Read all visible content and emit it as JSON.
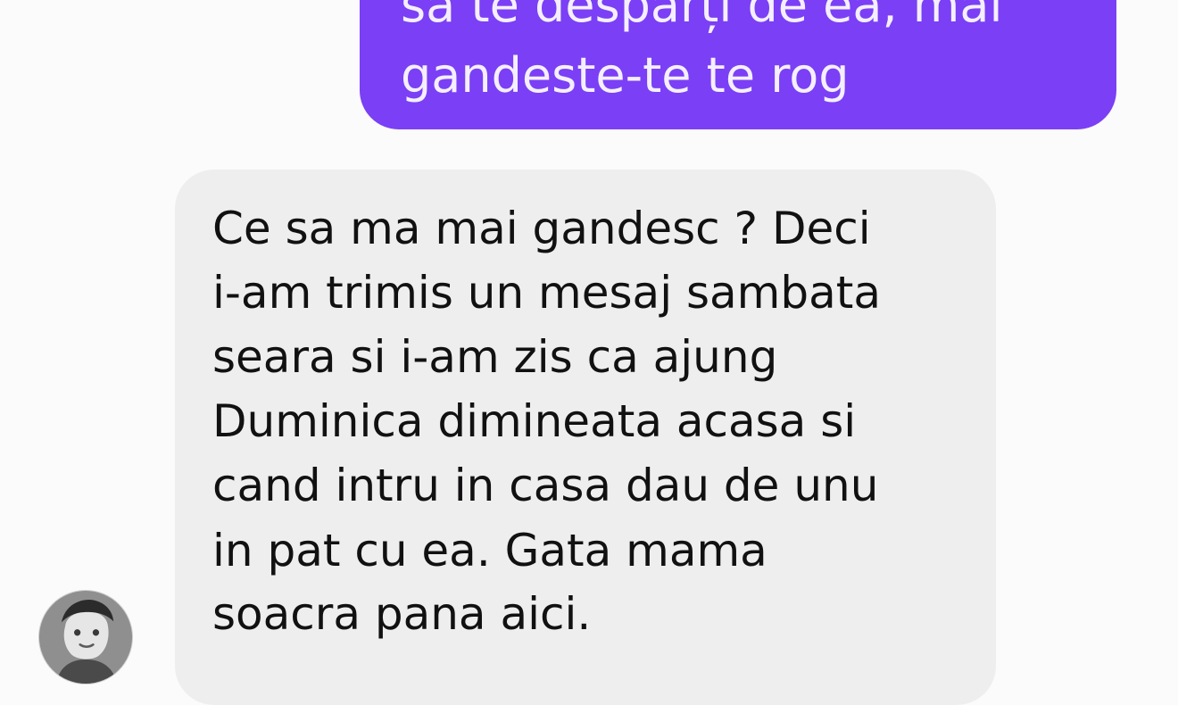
{
  "conversation": {
    "outgoing": {
      "lines": [
        "să te desparți de ea, mai",
        "gandeste-te te rog"
      ],
      "bubble_color": "#7b3ff5",
      "text_color": "#f4efff"
    },
    "incoming": {
      "lines": [
        "Ce sa ma mai gandesc ? Deci",
        "i-am trimis un mesaj sambata",
        "seara si i-am zis ca ajung",
        "Duminica dimineata acasa si",
        "cand intru in casa dau de unu",
        "in pat cu ea. Gata mama",
        "soacra pana aici."
      ],
      "bubble_color": "#efeeef",
      "text_color": "#111111"
    },
    "avatar_icon": "person-photo-icon"
  }
}
